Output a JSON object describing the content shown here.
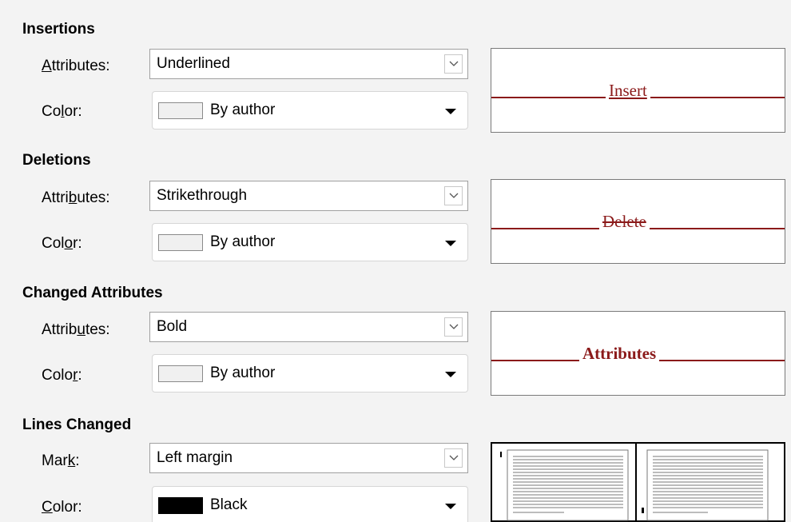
{
  "insertions": {
    "title": "Insertions",
    "attributes_label": "Attributes:",
    "attributes_value": "Underlined",
    "color_label": "Color:",
    "color_value": "By author",
    "color_swatch": "#f0f0f0",
    "preview_text": "Insert"
  },
  "deletions": {
    "title": "Deletions",
    "attributes_label": "Attributes:",
    "attributes_value": "Strikethrough",
    "color_label": "Color:",
    "color_value": "By author",
    "color_swatch": "#f0f0f0",
    "preview_text": "Delete"
  },
  "changed_attributes": {
    "title": "Changed Attributes",
    "attributes_label": "Attributes:",
    "attributes_value": "Bold",
    "color_label": "Color:",
    "color_value": "By author",
    "color_swatch": "#f0f0f0",
    "preview_text": "Attributes"
  },
  "lines_changed": {
    "title": "Lines Changed",
    "mark_label": "Mark:",
    "mark_value": "Left margin",
    "color_label": "Color:",
    "color_value": "Black",
    "color_swatch": "#000000"
  },
  "colors": {
    "preview_text": "#8b1a1a"
  }
}
